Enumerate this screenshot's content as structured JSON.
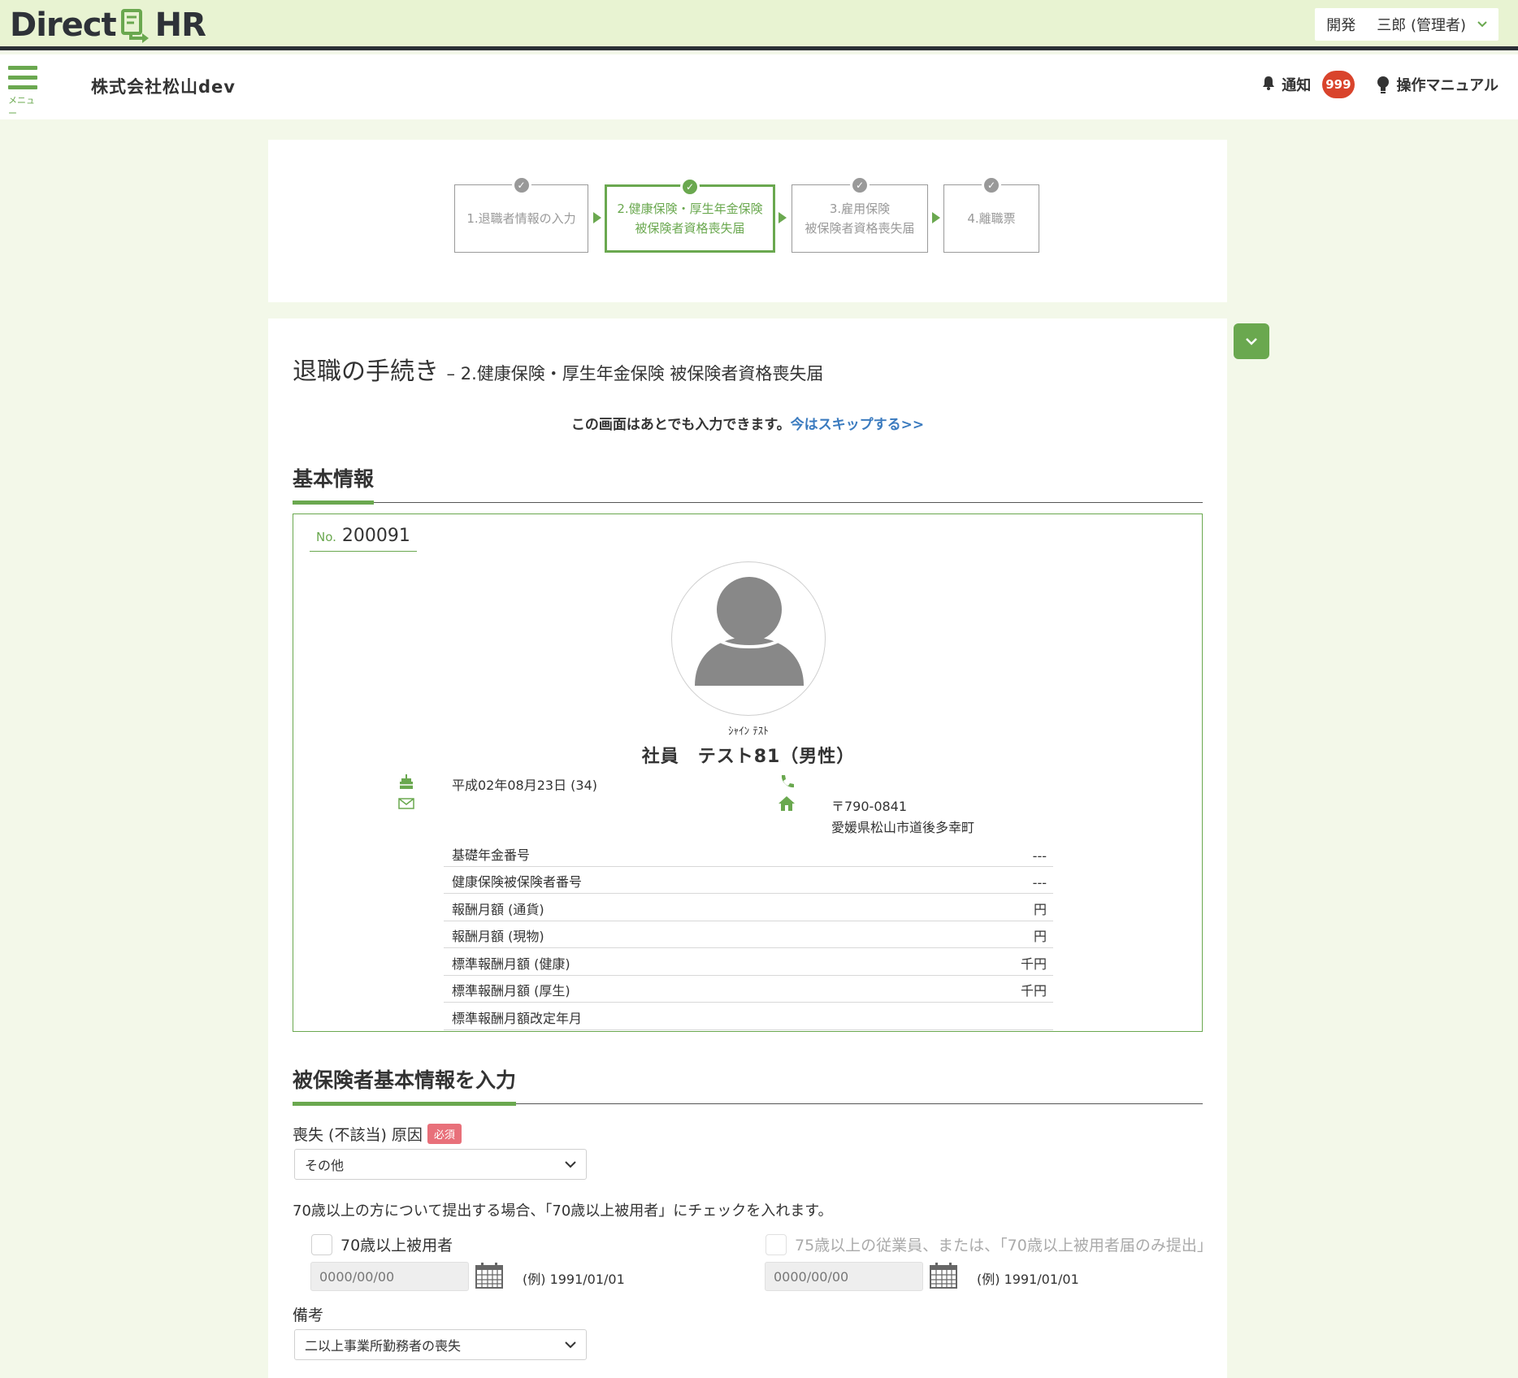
{
  "header": {
    "logo_left": "Direct",
    "logo_right": "HR",
    "user_dept": "開発",
    "user_name": "三郎 (管理者)"
  },
  "subheader": {
    "menu_label": "メニュー",
    "company": "株式会社松山dev",
    "notice_label": "通知",
    "notice_count": "999",
    "manual_label": "操作マニュアル"
  },
  "steps": [
    {
      "line1": "1.退職者情報の入力",
      "line2": ""
    },
    {
      "line1": "2.健康保険・厚生年金保険",
      "line2": "被保険者資格喪失届"
    },
    {
      "line1": "3.雇用保険",
      "line2": "被保険者資格喪失届"
    },
    {
      "line1": "4.離職票",
      "line2": ""
    }
  ],
  "page": {
    "title": "退職の手続き",
    "subtitle": "– 2.健康保険・厚生年金保険 被保険者資格喪失届",
    "skip_text": "この画面はあとでも入力できます。",
    "skip_link": "今はスキップする>>"
  },
  "basic_info": {
    "section_title": "基本情報",
    "no_label": "No.",
    "employee_no": "200091",
    "kana": "ｼｬｲﾝ ﾃｽﾄ",
    "name": "社員　テスト81（男性）",
    "birthday": "平成02年08月23日 (34)",
    "postal": "〒790-0841",
    "address": "愛媛県松山市道後多幸町",
    "rows": [
      {
        "label": "基礎年金番号",
        "value": "---"
      },
      {
        "label": "健康保険被保険者番号",
        "value": "---"
      },
      {
        "label": "報酬月額 (通貨)",
        "value": "円"
      },
      {
        "label": "報酬月額 (現物)",
        "value": "円"
      },
      {
        "label": "標準報酬月額 (健康)",
        "value": "千円"
      },
      {
        "label": "標準報酬月額 (厚生)",
        "value": "千円"
      },
      {
        "label": "標準報酬月額改定年月",
        "value": ""
      }
    ]
  },
  "insured": {
    "section_title": "被保険者基本情報を入力",
    "reason_label": "喪失 (不該当) 原因",
    "required": "必須",
    "reason_value": "その他",
    "note": "70歳以上の方について提出する場合、「70歳以上被用者」にチェックを入れます。",
    "check_70": "70歳以上被用者",
    "check_75": "75歳以上の従業員、または、「70歳以上被用者届のみ提出」",
    "date_placeholder": "0000/00/00",
    "date_example": "(例) 1991/01/01",
    "remarks_label": "備考",
    "remarks_value": "二以上事業所勤務者の喪失"
  },
  "colors": {
    "accent": "#6aa84f",
    "header_bg": "#e8f3d2",
    "badge": "#d9442c",
    "link": "#3b7bbf",
    "required": "#e8707a"
  }
}
